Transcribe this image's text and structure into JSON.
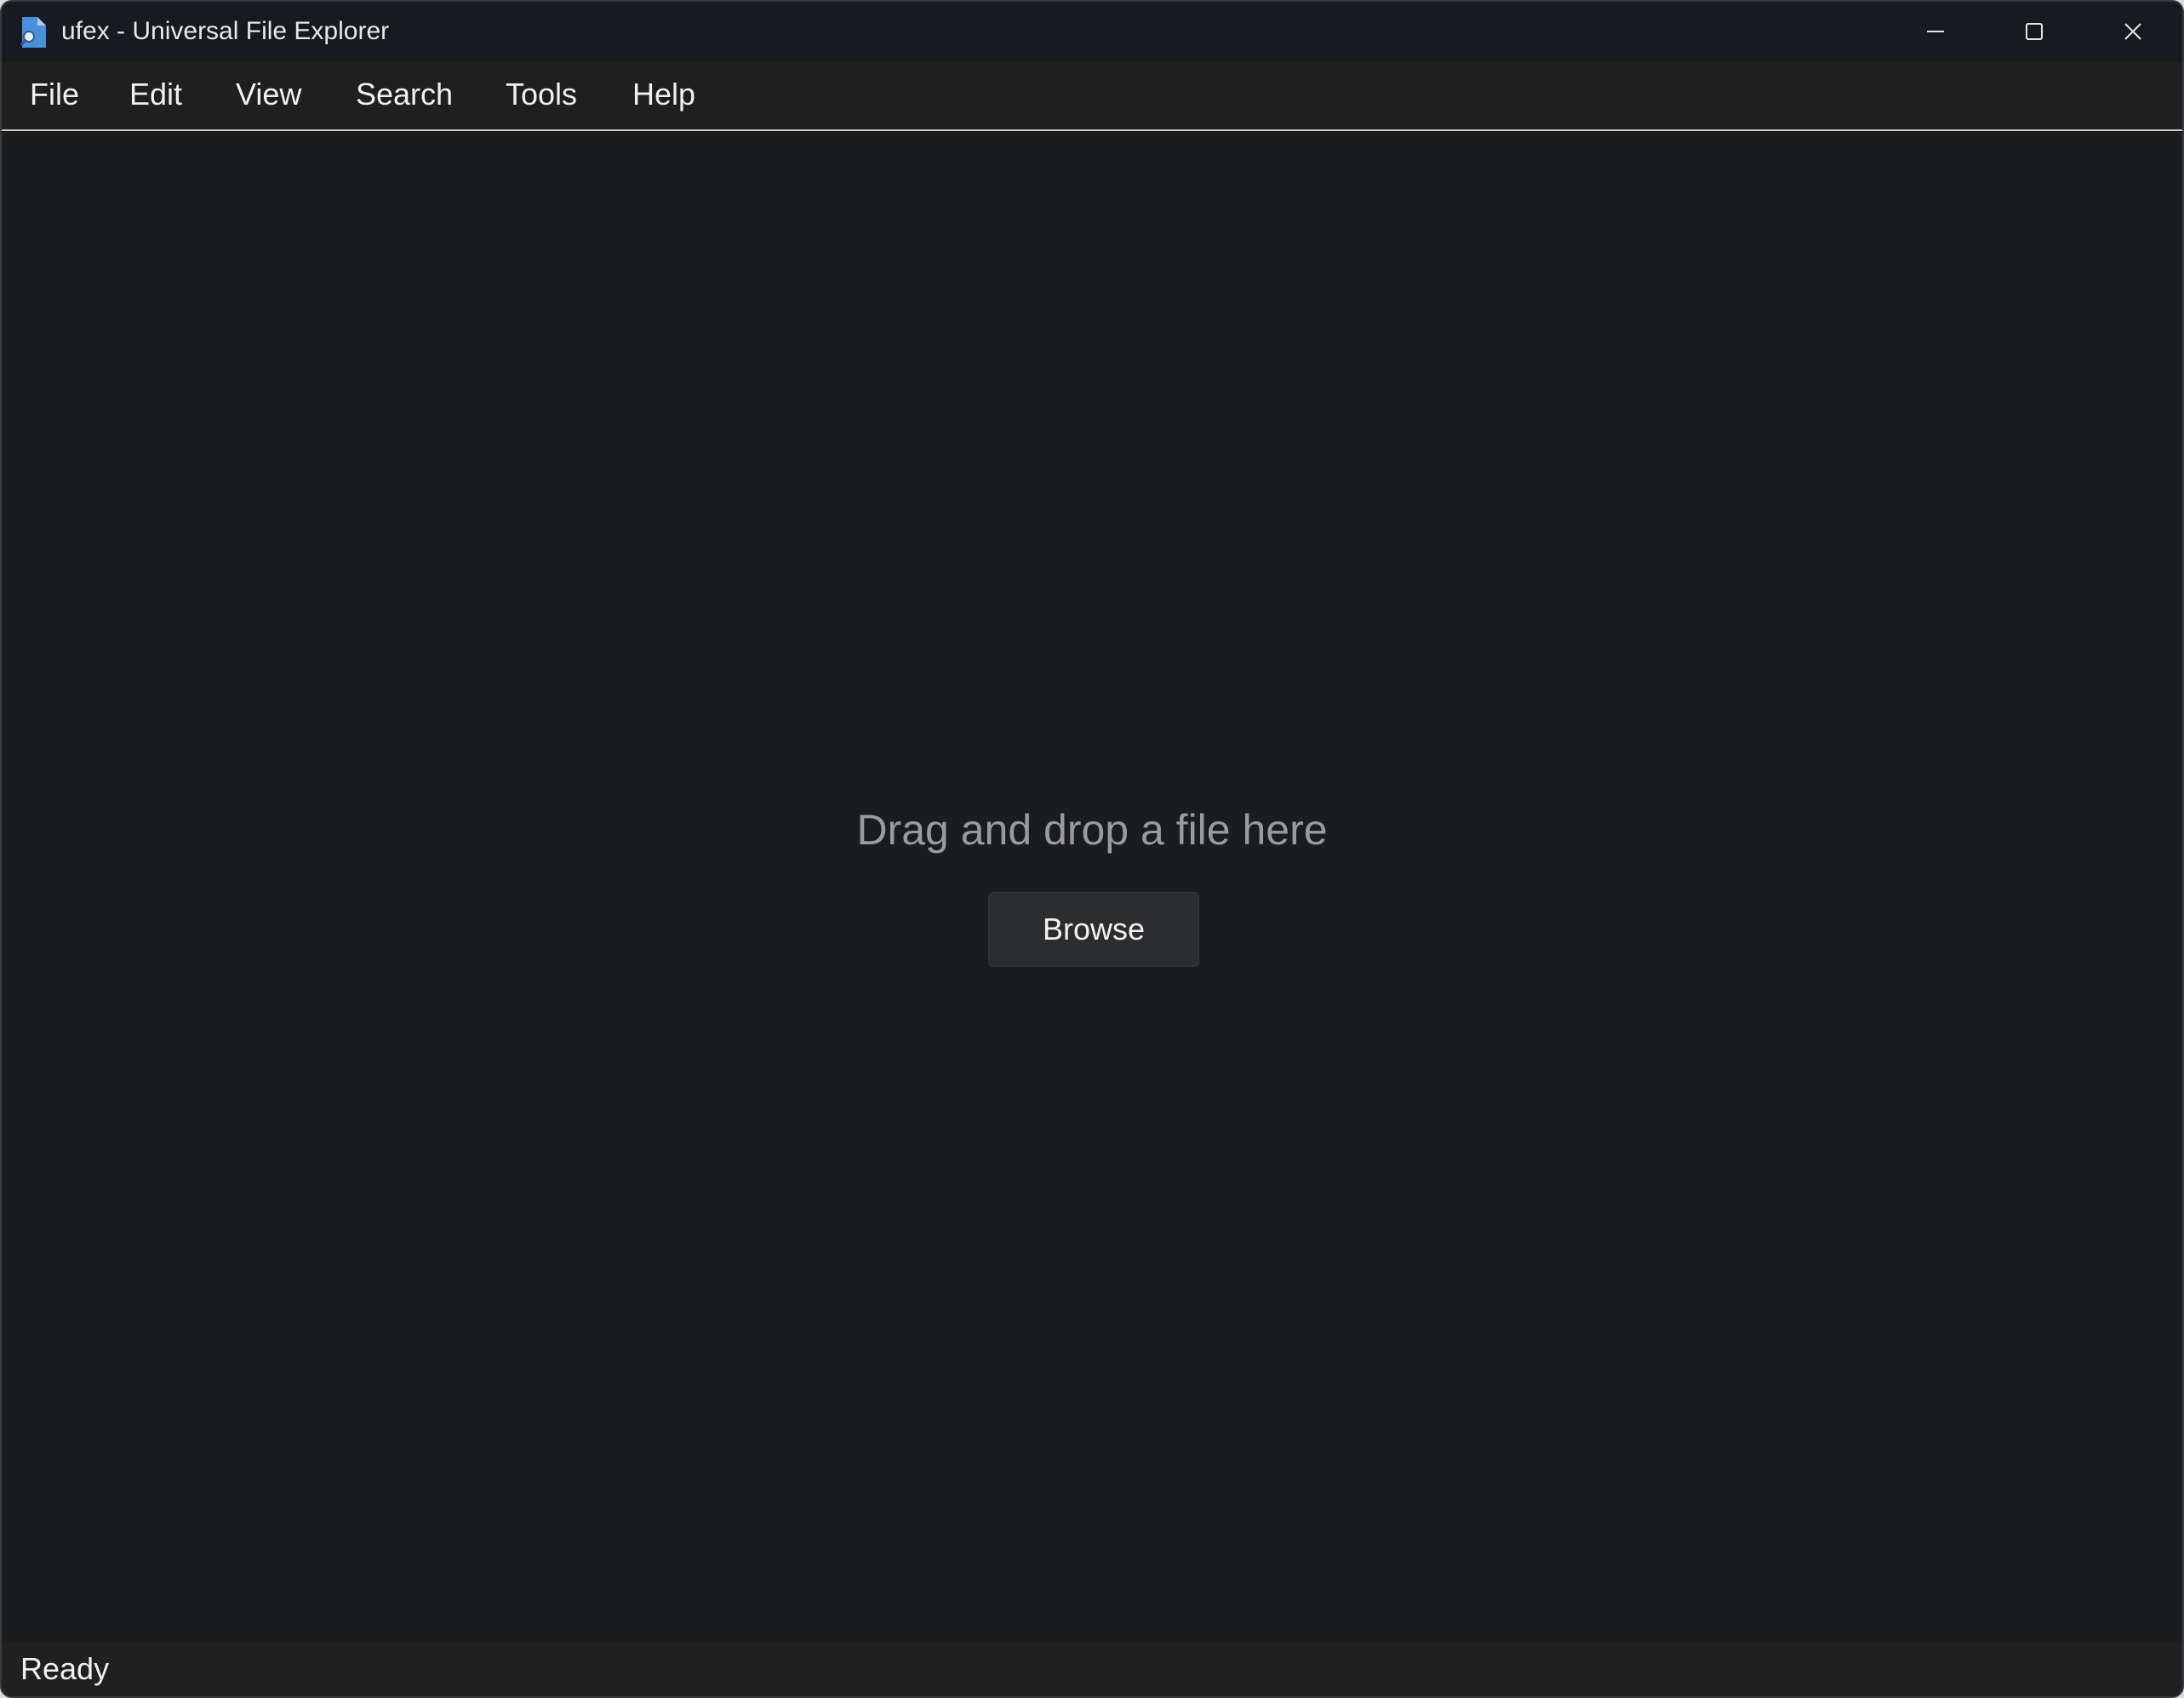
{
  "window": {
    "title": "ufex - Universal File Explorer",
    "icon": "document-search-icon",
    "controls": [
      "minimize-icon",
      "maximize-icon",
      "close-icon"
    ]
  },
  "menu": {
    "items": [
      {
        "label": "File"
      },
      {
        "label": "Edit"
      },
      {
        "label": "View"
      },
      {
        "label": "Search"
      },
      {
        "label": "Tools"
      },
      {
        "label": "Help"
      }
    ]
  },
  "main": {
    "drop_hint": "Drag and drop a file here",
    "browse_label": "Browse"
  },
  "status": {
    "text": "Ready"
  },
  "colors": {
    "background": "#1b1c1e",
    "titlebar": "#171a1e",
    "menubar": "#1f1f20",
    "button": "#2c2d2f",
    "hint_text": "#9a9b9d"
  }
}
